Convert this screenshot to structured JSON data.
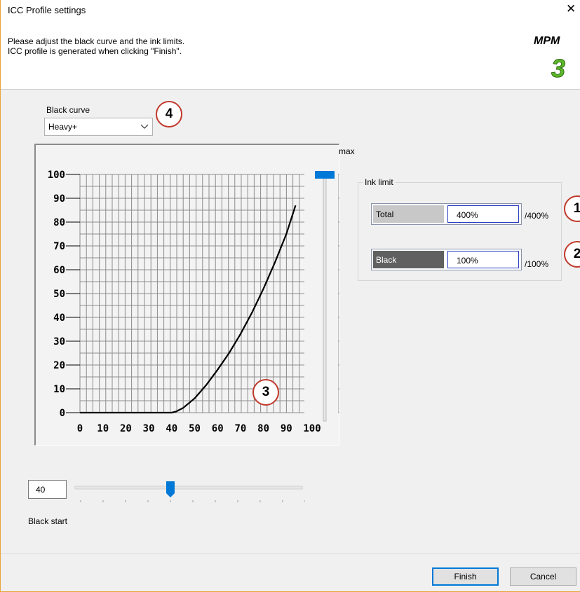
{
  "window": {
    "title": "ICC Profile settings",
    "close_glyph": "✕"
  },
  "instructions": {
    "line1": "Please adjust the black curve and the ink limits.",
    "line2": "ICC profile is generated when clicking \"Finish\"."
  },
  "logo": {
    "text": "MPM",
    "digit": "3",
    "digit_color": "#5cb829"
  },
  "black_curve": {
    "label": "Black curve",
    "selected": "Heavy+"
  },
  "chart_data": {
    "type": "line",
    "x_ticks": [
      "0",
      "10",
      "20",
      "30",
      "40",
      "50",
      "60",
      "70",
      "80",
      "90",
      "100"
    ],
    "y_ticks": [
      "100",
      "90",
      "80",
      "70",
      "60",
      "50",
      "40",
      "30",
      "20",
      "10",
      "0"
    ],
    "xlim": [
      0,
      100
    ],
    "ylim": [
      0,
      100
    ],
    "grid": true,
    "series": [
      {
        "x": [
          0,
          10,
          20,
          30,
          40,
          42,
          45,
          50,
          55,
          60,
          65,
          70,
          75,
          80,
          85,
          90,
          94
        ],
        "y": [
          0,
          0,
          0,
          0,
          0,
          0.5,
          2,
          6,
          11.5,
          18,
          25,
          33,
          42,
          52,
          63,
          75,
          87
        ]
      }
    ]
  },
  "max_slider": {
    "label": "max",
    "value": 100
  },
  "ink_limit": {
    "title": "Ink limit",
    "total": {
      "label": "Total",
      "value": "400%",
      "max": "/400%",
      "label_bg": "#c8c8c8"
    },
    "black": {
      "label": "Black",
      "value": "100%",
      "max": "/100%",
      "label_bg": "#606060"
    }
  },
  "black_start": {
    "label": "Black start",
    "value": "40",
    "slider_value": 40
  },
  "callouts": {
    "c1": "1",
    "c2": "2",
    "c3": "3",
    "c4": "4"
  },
  "buttons": {
    "finish": "Finish",
    "cancel": "Cancel"
  },
  "colors": {
    "accent": "#0078d7",
    "callout_border": "#c0392b"
  }
}
